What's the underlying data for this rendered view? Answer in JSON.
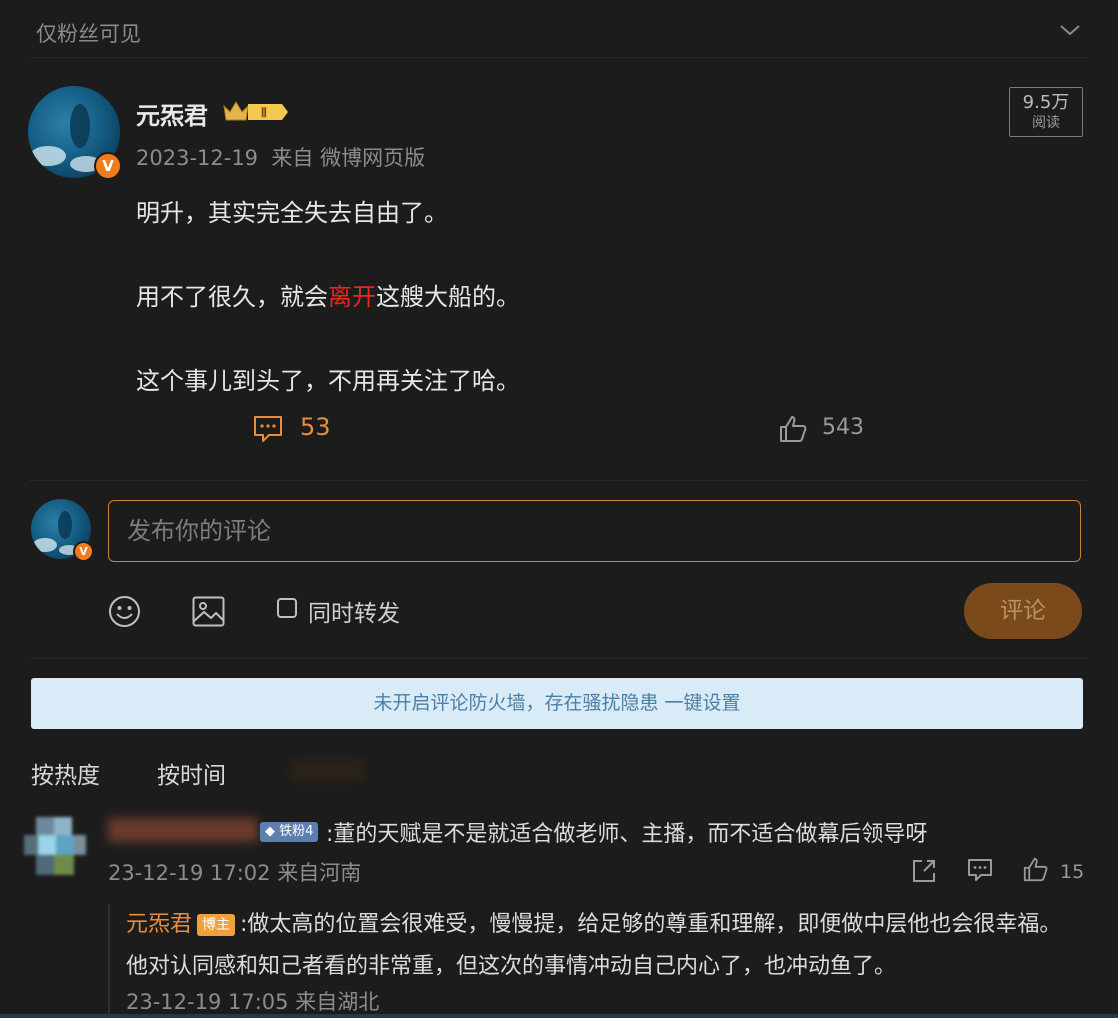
{
  "header": {
    "visibility": "仅粉丝可见"
  },
  "post": {
    "author": "元炁君",
    "rank_badge": "Ⅱ",
    "meta": "2023-12-19  来自 微博网页版",
    "read_count": "9.5万",
    "read_label": "阅读",
    "lines": [
      {
        "before": "明升，其实完全失去自由了。",
        "highlight": "",
        "after": ""
      },
      {
        "before": "用不了很久，就会",
        "highlight": "离开",
        "after": "这艘大船的。"
      },
      {
        "before": "这个事儿到头了，不用再关注了哈。",
        "highlight": "",
        "after": ""
      }
    ],
    "comment_count": "53",
    "like_count": "543"
  },
  "composer": {
    "placeholder": "发布你的评论",
    "repost_label": "同时转发",
    "submit_label": "评论"
  },
  "firewall_notice": "未开启评论防火墙，存在骚扰隐患 一键设置",
  "sort_tabs": [
    "按热度",
    "按时间"
  ],
  "comments": [
    {
      "fan_badge": "铁粉4",
      "text": ":董的天赋是不是就适合做老师、主播，而不适合做幕后领导呀",
      "meta": "23-12-19 17:02 来自河南",
      "like_count": "15",
      "reply": {
        "author": "元炁君",
        "badge": "博主",
        "text": ":做太高的位置会很难受，慢慢提，给足够的尊重和理解，即便做中层他也会很幸福。他对认同感和知己者看的非常重，但这次的事情冲动自己内心了，也冲动鱼了。",
        "meta": "23-12-19 17:05 来自湖北"
      }
    }
  ],
  "colors": {
    "background": "#1c1c1c",
    "accent": "#e98d3a",
    "highlight": "#e8291c",
    "verified": "#f27b1b"
  }
}
